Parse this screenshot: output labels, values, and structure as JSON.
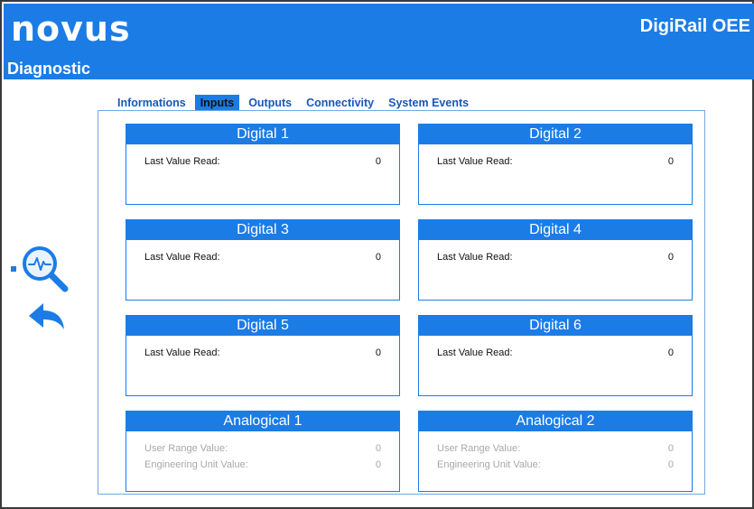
{
  "header": {
    "logo": "novus",
    "app_title": "DigiRail OEE",
    "page_title": "Diagnostic"
  },
  "tabs": [
    {
      "label": "Informations",
      "active": false
    },
    {
      "label": "Inputs",
      "active": true
    },
    {
      "label": "Outputs",
      "active": false
    },
    {
      "label": "Connectivity",
      "active": false
    },
    {
      "label": "System Events",
      "active": false
    }
  ],
  "cards": [
    {
      "title": "Digital 1",
      "rows": [
        {
          "label": "Last Value Read:",
          "value": "0"
        }
      ]
    },
    {
      "title": "Digital 2",
      "rows": [
        {
          "label": "Last Value Read:",
          "value": "0"
        }
      ]
    },
    {
      "title": "Digital 3",
      "rows": [
        {
          "label": "Last Value Read:",
          "value": "0"
        }
      ]
    },
    {
      "title": "Digital 4",
      "rows": [
        {
          "label": "Last Value Read:",
          "value": "0"
        }
      ]
    },
    {
      "title": "Digital 5",
      "rows": [
        {
          "label": "Last Value Read:",
          "value": "0"
        }
      ]
    },
    {
      "title": "Digital 6",
      "rows": [
        {
          "label": "Last Value Read:",
          "value": "0"
        }
      ]
    },
    {
      "title": "Analogical 1",
      "rows": [
        {
          "label": "User Range Value:",
          "value": "0"
        },
        {
          "label": "Engineering Unit Value:",
          "value": "0"
        }
      ]
    },
    {
      "title": "Analogical 2",
      "rows": [
        {
          "label": "User Range Value:",
          "value": "0"
        },
        {
          "label": "Engineering Unit Value:",
          "value": "0"
        }
      ]
    }
  ],
  "side_icons": {
    "diagnostic": "diagnostic-search-icon",
    "back": "back-arrow-icon"
  },
  "colors": {
    "accent": "#1b7ce6",
    "tab_text": "#1a57b8",
    "dim_text": "#a8a8a8"
  }
}
